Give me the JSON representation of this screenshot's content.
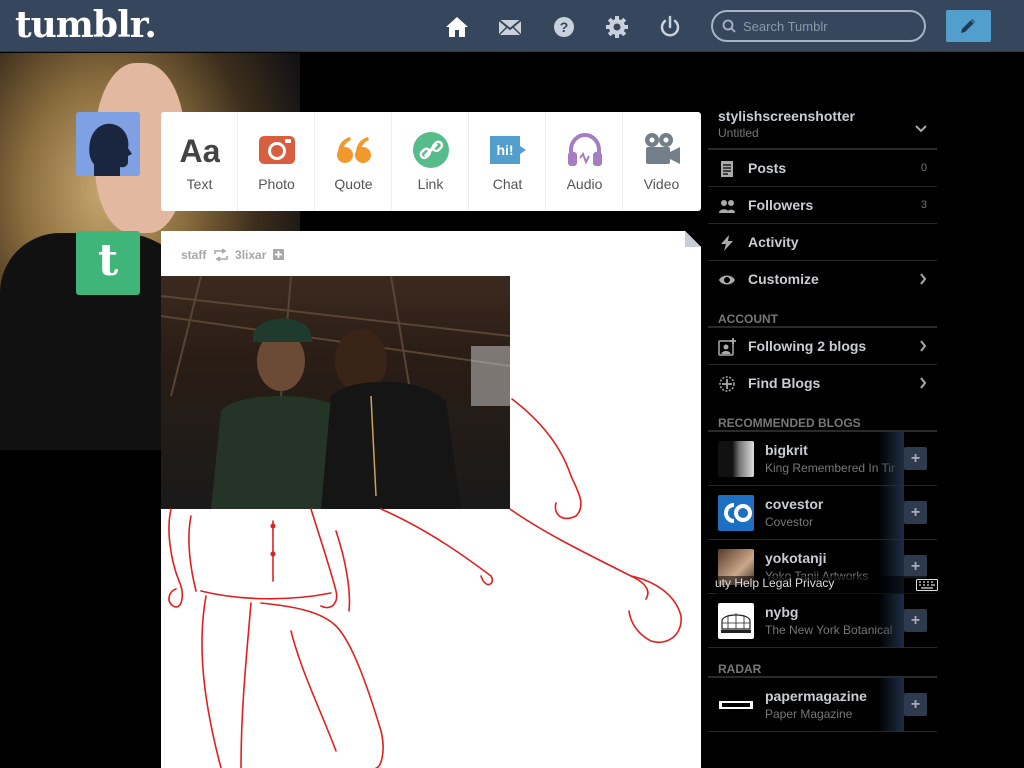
{
  "header": {
    "logo": "tumblr.",
    "search_placeholder": "Search Tumblr"
  },
  "post_types": [
    {
      "label": "Text",
      "icon": "text-icon",
      "color": "#444444"
    },
    {
      "label": "Photo",
      "icon": "photo-icon",
      "color": "#d95e40"
    },
    {
      "label": "Quote",
      "icon": "quote-icon",
      "color": "#f2992e"
    },
    {
      "label": "Link",
      "icon": "link-icon",
      "color": "#56bc8a"
    },
    {
      "label": "Chat",
      "icon": "chat-icon",
      "color": "#529ecc"
    },
    {
      "label": "Audio",
      "icon": "audio-icon",
      "color": "#a77dc2"
    },
    {
      "label": "Video",
      "icon": "video-icon",
      "color": "#748089"
    }
  ],
  "post": {
    "author": "staff",
    "reblogged_from": "3lixar"
  },
  "sidebar": {
    "blog_name": "stylishscreenshotter",
    "blog_title": "Untitled",
    "items": [
      {
        "label": "Posts",
        "count": "0"
      },
      {
        "label": "Followers",
        "count": "3"
      },
      {
        "label": "Activity"
      },
      {
        "label": "Customize"
      }
    ],
    "account_header": "ACCOUNT",
    "account_items": [
      {
        "label": "Following 2 blogs"
      },
      {
        "label": "Find Blogs"
      }
    ],
    "recommended_header": "RECOMMENDED BLOGS",
    "recommended": [
      {
        "name": "bigkrit",
        "desc": "King Remembered In Time"
      },
      {
        "name": "covestor",
        "desc": "Covestor"
      },
      {
        "name": "yokotanji",
        "desc": "Yoko Tanji Artworks"
      },
      {
        "name": "nybg",
        "desc": "The New York Botanical Garden"
      }
    ],
    "overlay_text": "uty  Help  Legal  Privacy",
    "radar_header": "RADAR",
    "radar": [
      {
        "name": "papermagazine",
        "desc": "Paper Magazine"
      }
    ]
  },
  "colors": {
    "topbar": "#36465d",
    "compose": "#529ecc",
    "staff_avatar": "#3fb57a"
  }
}
